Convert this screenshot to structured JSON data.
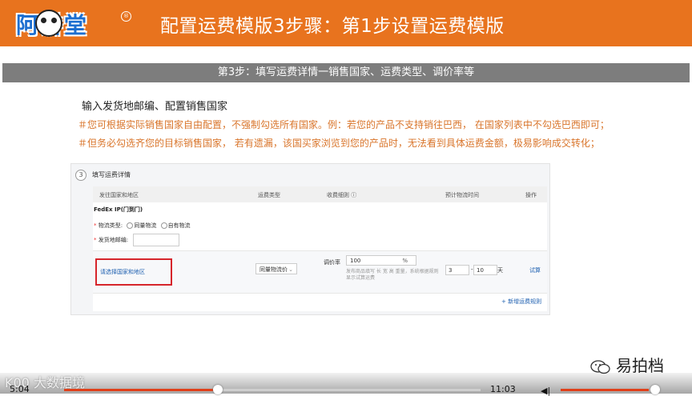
{
  "banner": {
    "logo_text": "阿讲堂",
    "logo_registered": "®",
    "title": "配置运费模版3步骤：第1步设置运费模版"
  },
  "step_bar": "第3步：填写运费详情一销售国家、运费类型、调价率等",
  "intro": "输入发货地邮编、配置销售国家",
  "notes": [
    "＃您可根据实际销售国家自由配置，不强制勾选所有国家。例：若您的产品不支持销往巴西，   在国家列表中不勾选巴西即可；",
    "＃但务必勾选齐您的目标销售国家，   若有遗漏，该国买家浏览到您的产品时，无法看到具体运费金额，极易影响成交转化；"
  ],
  "screenshot": {
    "section_number": "3",
    "section_title": "填写运费详情",
    "headers": [
      "发往国家和地区",
      "运费类型",
      "收费细则 ⓘ",
      "预计物流时间",
      "操作"
    ],
    "carrier": "FedEx IP(门到门)",
    "logistics_type_label": "物流类型:",
    "logistics_options": [
      "同量物流",
      "自有物流"
    ],
    "zip_label": "发货地邮编:",
    "zip_value": "",
    "row": {
      "country_link": "请选择国家和地区",
      "freight_type": "同量物流价",
      "rate_label": "调价率",
      "rate_value": "100",
      "rate_unit": "%",
      "rate_hint": "发布商品填写 长 宽 高 重量，系统根据规则显示试算运费",
      "days_from": "3",
      "days_to": "10",
      "days_unit": "天",
      "action": "试算"
    },
    "add_rule": "+ 新增运费规则"
  },
  "watermark": {
    "brand": "易拍档",
    "video_logo": "K00 大数据境"
  },
  "player": {
    "time_current": "5:04",
    "time_total": "11:03",
    "progress": 0.37
  },
  "colors": {
    "banner": "#e8731e",
    "note": "#d9752b",
    "highlight_box": "#d6252b",
    "link": "#1d5fb0"
  }
}
